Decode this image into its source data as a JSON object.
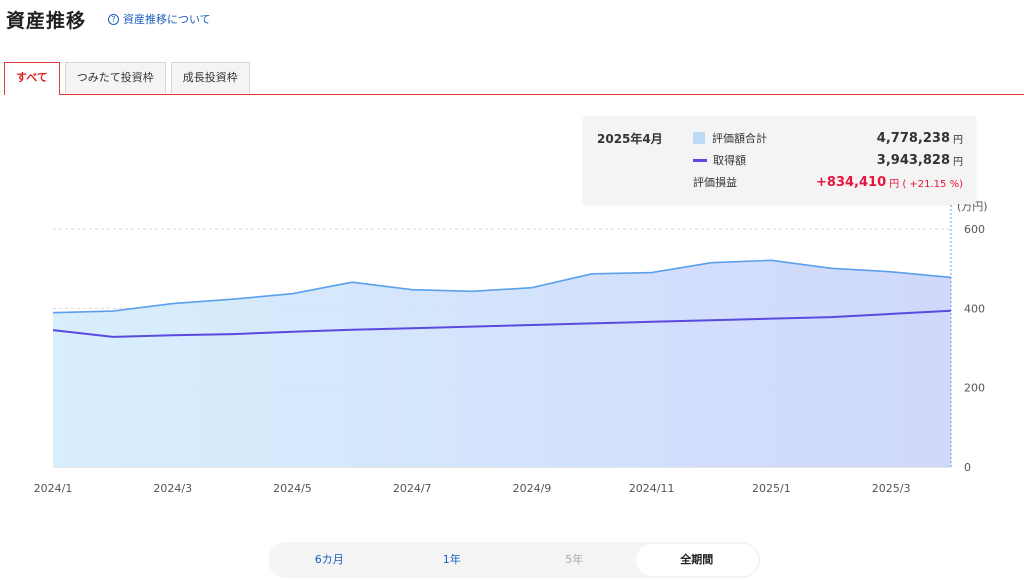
{
  "page": {
    "title": "資産推移",
    "help_link": "資産推移について"
  },
  "tabs": [
    {
      "label": "すべて",
      "active": true
    },
    {
      "label": "つみたて投資枠",
      "active": false
    },
    {
      "label": "成長投資枠",
      "active": false
    }
  ],
  "tooltip": {
    "date": "2025年4月",
    "rows": [
      {
        "label": "評価額合計",
        "value": "4,778,238",
        "unit": "円"
      },
      {
        "label": "取得額",
        "value": "3,943,828",
        "unit": "円"
      },
      {
        "label": "評価損益",
        "value": "+834,410",
        "unit": "円 ( +21.15 %)"
      }
    ]
  },
  "periods": [
    {
      "label": "6カ月",
      "state": "normal"
    },
    {
      "label": "1年",
      "state": "normal"
    },
    {
      "label": "5年",
      "state": "disabled"
    },
    {
      "label": "全期間",
      "state": "active"
    }
  ],
  "colors": {
    "accent_red": "#e03c3c",
    "link_blue": "#1a5fc0",
    "valuation_line": "#5aa0ec",
    "cost_line": "#5a4ae0",
    "gain": "#e5153d"
  },
  "chart_data": {
    "type": "area",
    "unit_label": "(万円)",
    "ylim": [
      0,
      600
    ],
    "y_ticks": [
      0,
      200,
      400,
      600
    ],
    "x_tick_labels": [
      "2024/1",
      "2024/3",
      "2024/5",
      "2024/7",
      "2024/9",
      "2024/11",
      "2025/1",
      "2025/3"
    ],
    "x": [
      "2024/1",
      "2024/2",
      "2024/3",
      "2024/4",
      "2024/5",
      "2024/6",
      "2024/7",
      "2024/8",
      "2024/9",
      "2024/10",
      "2024/11",
      "2024/12",
      "2025/1",
      "2025/2",
      "2025/3",
      "2025/4"
    ],
    "series": [
      {
        "name": "評価額合計",
        "values": [
          389,
          393,
          412,
          423,
          437,
          466,
          447,
          443,
          452,
          487,
          490,
          515,
          521,
          501,
          492,
          478
        ]
      },
      {
        "name": "取得額",
        "values": [
          345,
          328,
          332,
          335,
          341,
          346,
          350,
          354,
          358,
          362,
          366,
          370,
          374,
          378,
          386,
          394
        ]
      }
    ],
    "grid": true,
    "legend": "tooltip"
  }
}
